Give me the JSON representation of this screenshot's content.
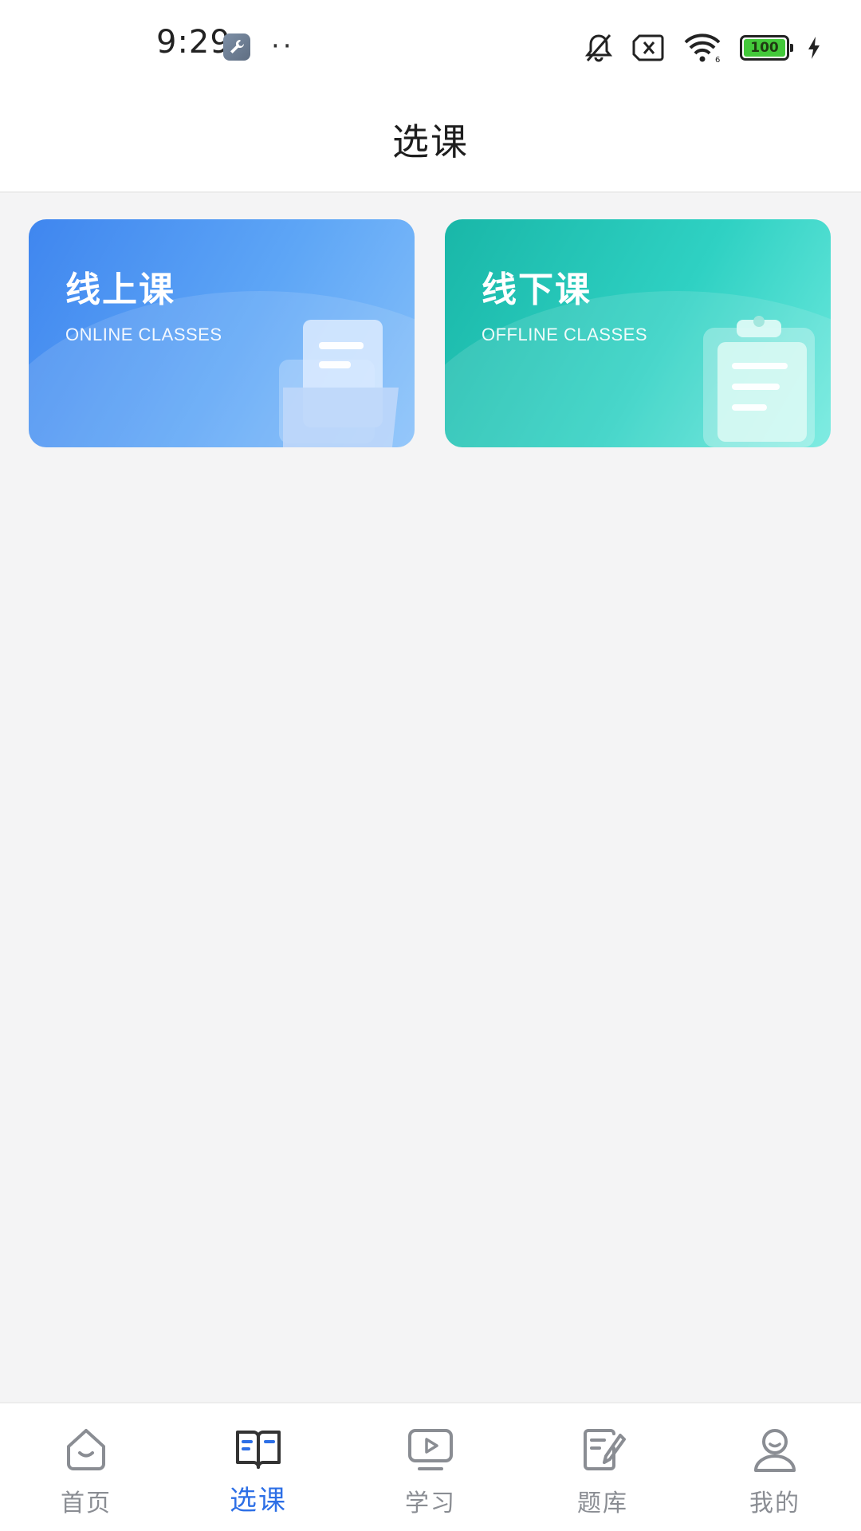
{
  "status_bar": {
    "time": "9:29",
    "dots": "··",
    "battery": "100"
  },
  "header": {
    "title": "选课"
  },
  "cards": [
    {
      "title": "线上课",
      "subtitle": "ONLINE CLASSES",
      "color": "#4a90f0"
    },
    {
      "title": "线下课",
      "subtitle": "OFFLINE CLASSES",
      "color": "#22c4b5"
    }
  ],
  "bottom_nav": {
    "active_color": "#2d6fe6",
    "items": [
      {
        "label": "首页",
        "icon": "home-icon"
      },
      {
        "label": "选课",
        "icon": "book-icon"
      },
      {
        "label": "学习",
        "icon": "play-screen-icon"
      },
      {
        "label": "题库",
        "icon": "edit-note-icon"
      },
      {
        "label": "我的",
        "icon": "user-icon"
      }
    ]
  }
}
